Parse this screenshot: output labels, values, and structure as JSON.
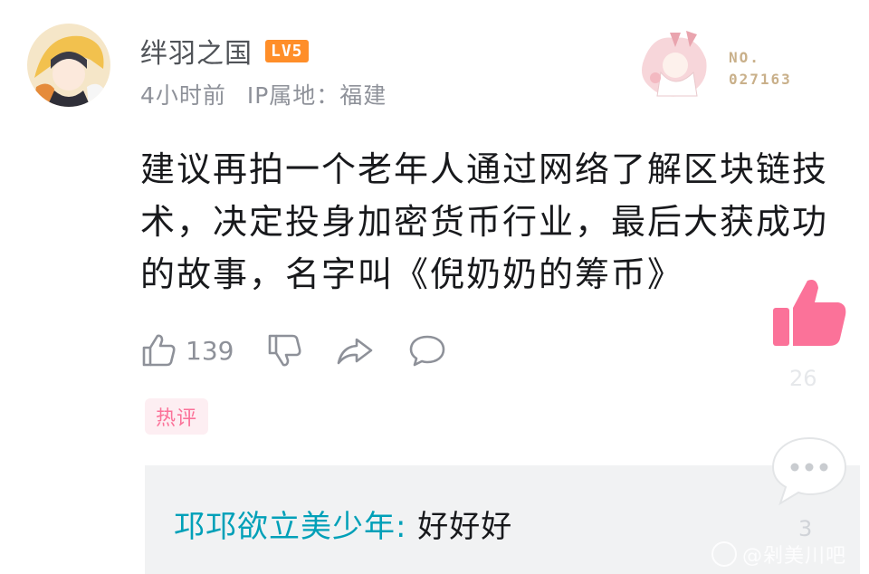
{
  "comment": {
    "username": "绊羽之国",
    "level": "LV5",
    "time": "4小时前",
    "ip_location": "IP属地：福建",
    "fan_number_label": "NO.",
    "fan_number": "027163",
    "content": "建议再拍一个老年人通过网络了解区块链技术，决定投身加密货币行业，最后大获成功的故事，名字叫《倪奶奶的筹币》",
    "like_count": "139",
    "hot_tag": "热评"
  },
  "reply": {
    "user": "邛邛欲立美少年:",
    "text": " 好好好"
  },
  "floating": {
    "like_count": "26",
    "comment_count": "3"
  },
  "watermark": "@剁美川吧",
  "colors": {
    "level_badge": "#ff8e29",
    "hot_tag": "#fb7299",
    "reply_user": "#00a0b8",
    "float_like": "#fb7299"
  }
}
